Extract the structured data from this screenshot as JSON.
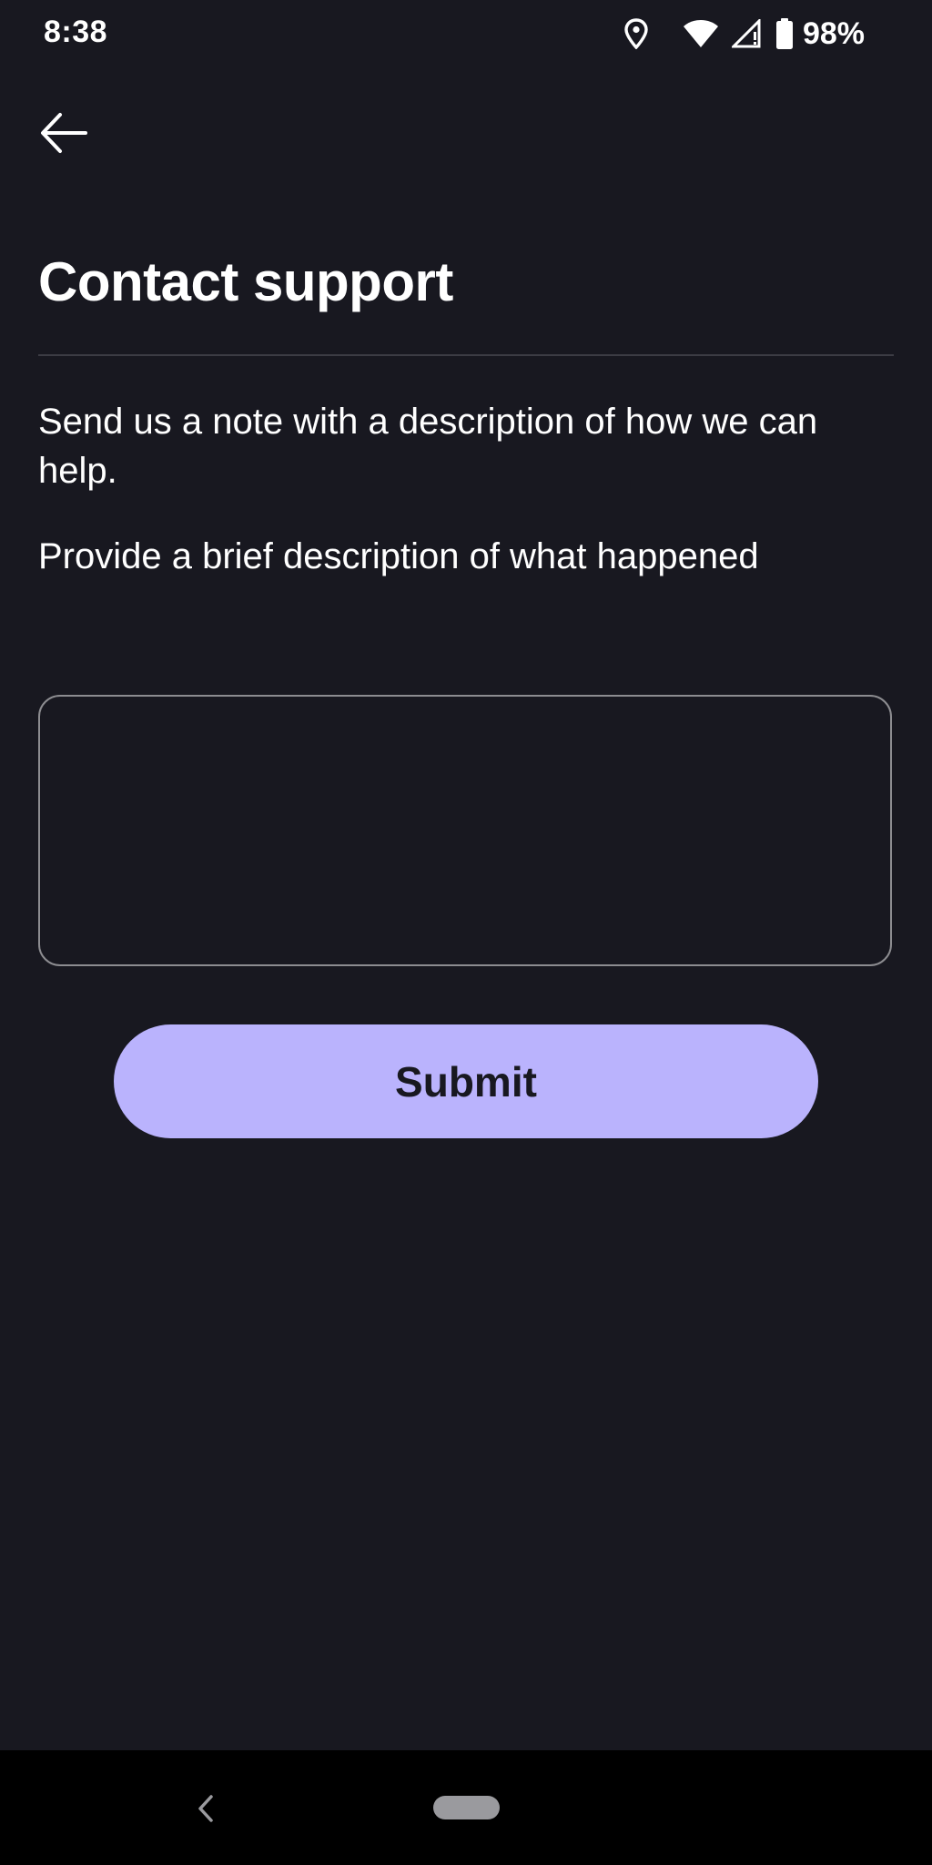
{
  "status_bar": {
    "time": "8:38",
    "battery": "98%",
    "icons": [
      "location-icon",
      "wifi-icon",
      "signal-icon",
      "battery-icon"
    ]
  },
  "header": {
    "back_icon": "arrow-left-icon",
    "title": "Contact support"
  },
  "form": {
    "intro": "Send us a note with a description of how we can help.",
    "field_label": "Provide a brief description of what happened",
    "description_value": "",
    "description_placeholder": "",
    "submit_label": "Submit"
  },
  "nav_bar": {
    "back_icon": "chevron-left-icon",
    "home_icon": "home-pill-icon"
  },
  "colors": {
    "background": "#181820",
    "accent": "#bab3fd",
    "divider": "#3c3c44",
    "input_border": "#8c8c90"
  }
}
